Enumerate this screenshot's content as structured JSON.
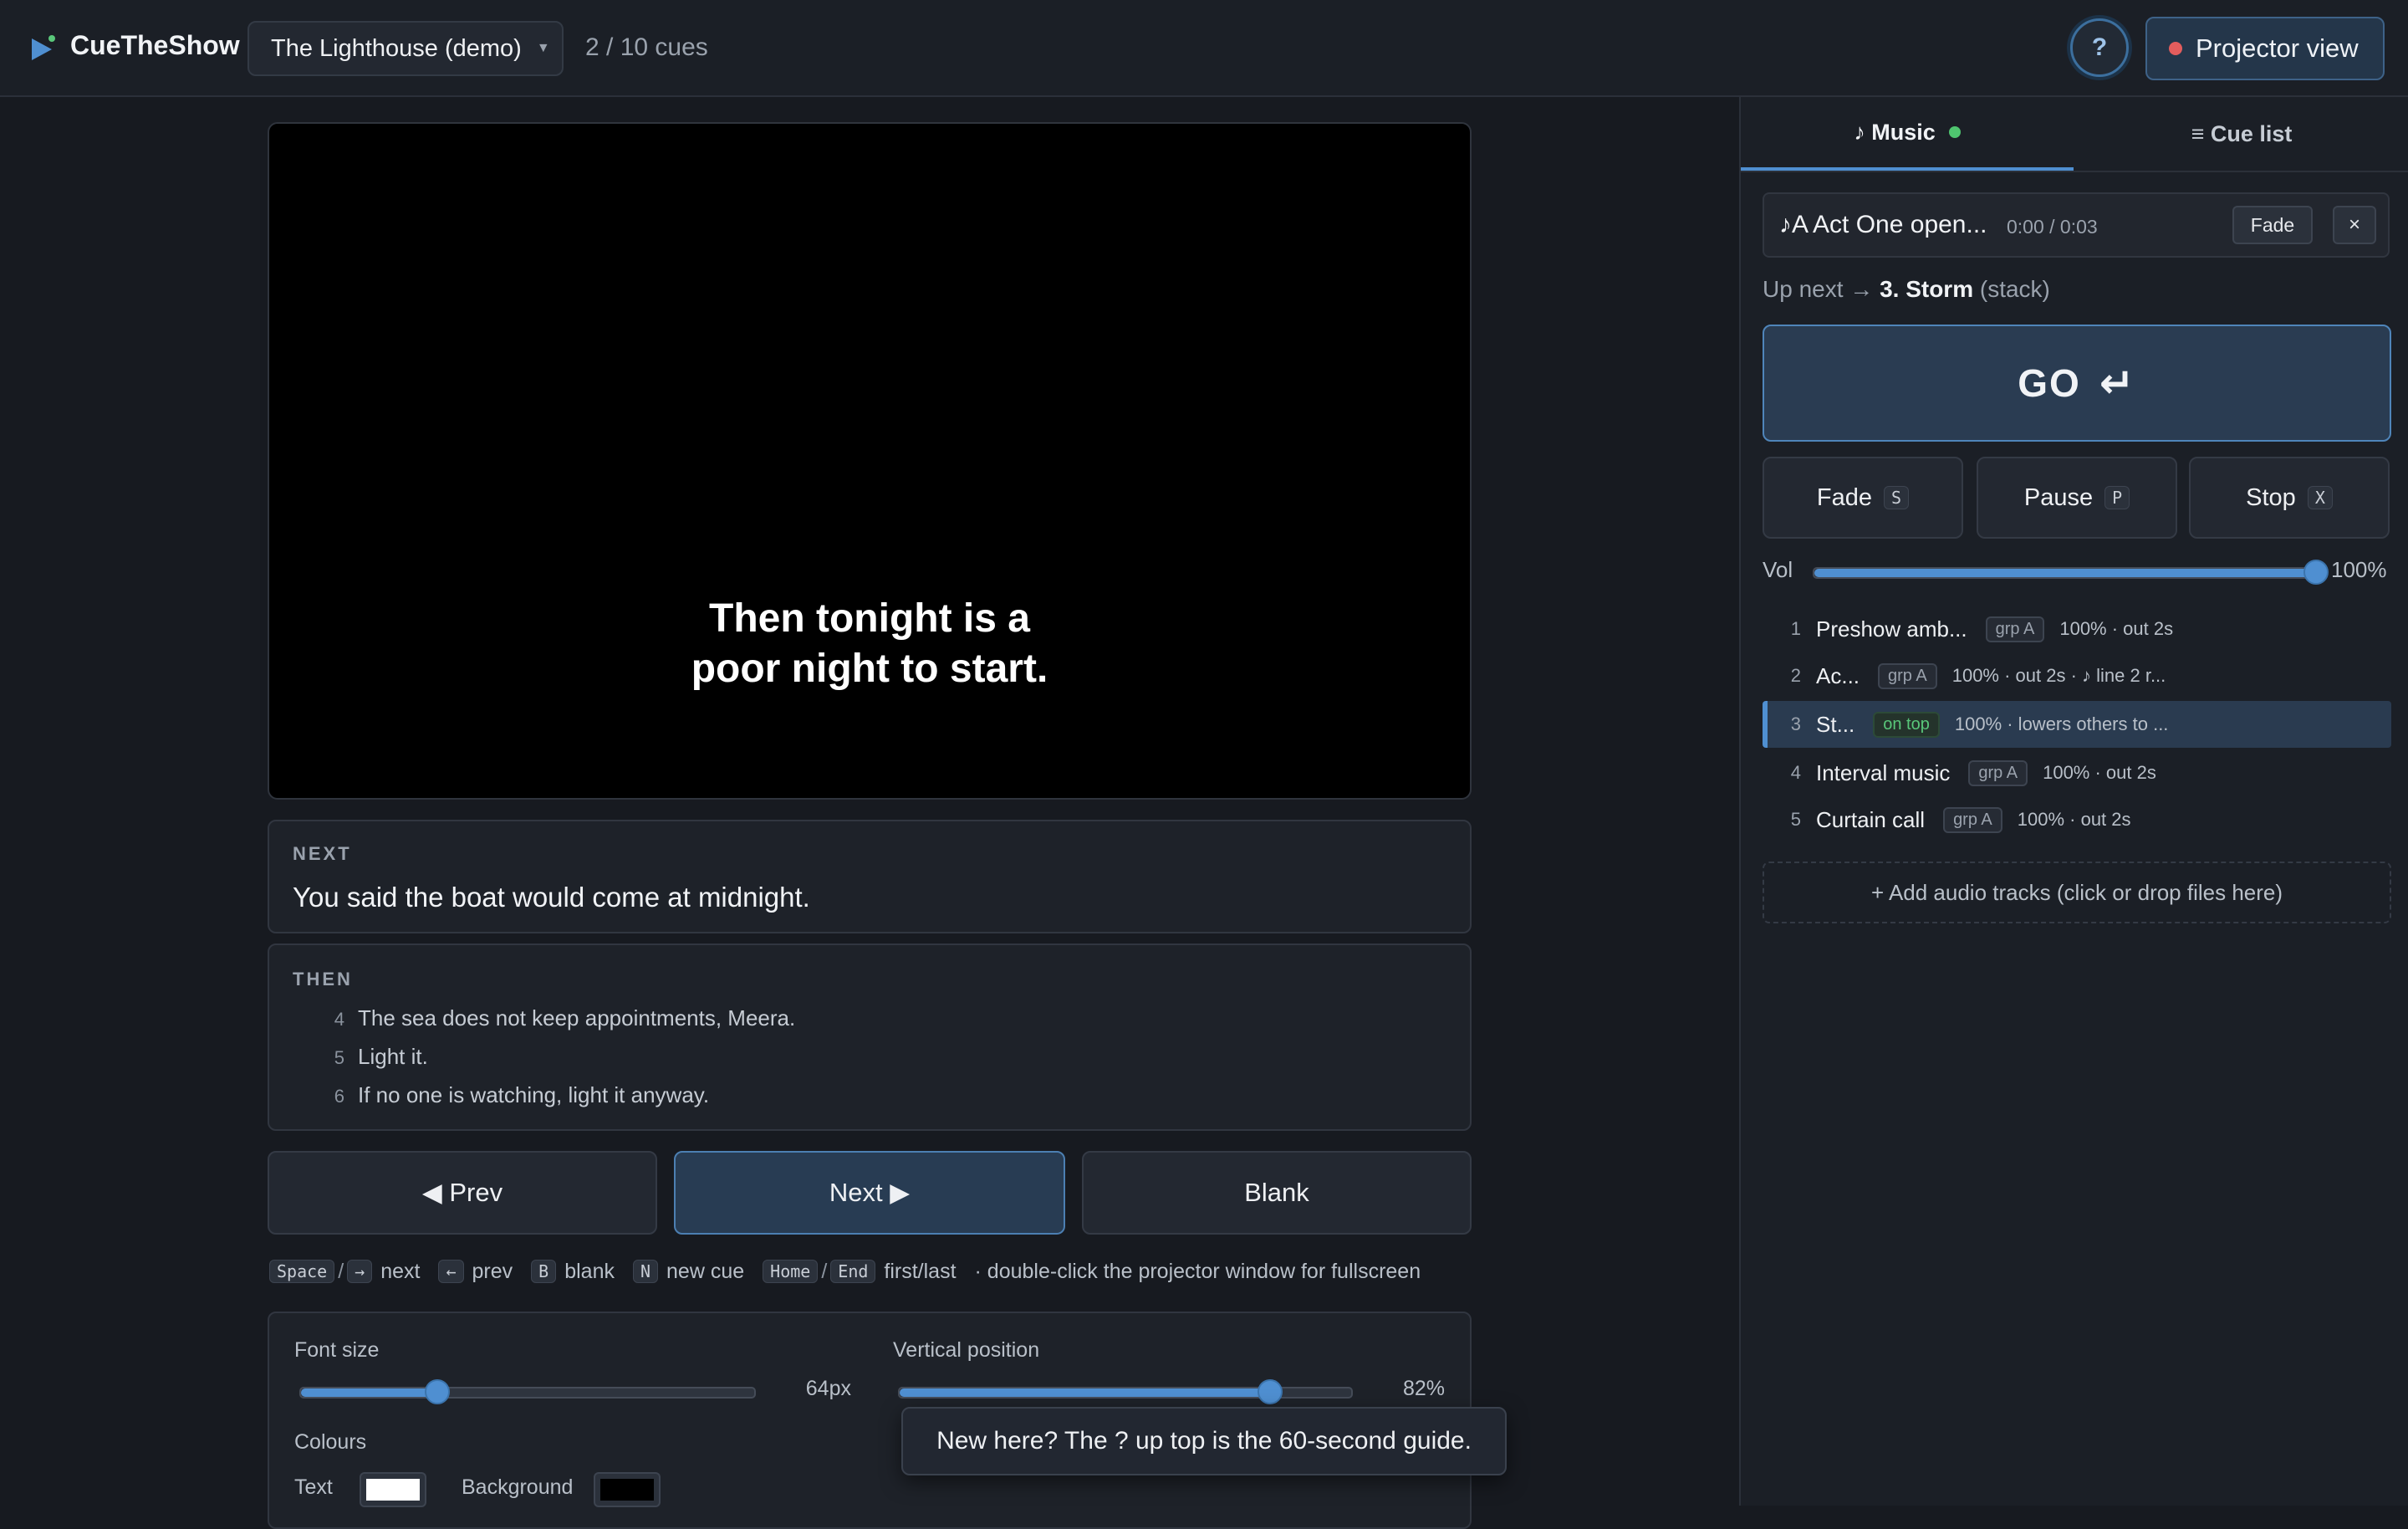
{
  "app": {
    "brand": "CueTheShow",
    "project": "The Lighthouse (demo)",
    "cue_count": "2 / 10 cues",
    "help_label": "?",
    "projector_label": "Projector view",
    "accent_color": "#4f8fd1"
  },
  "stage": {
    "line1": "Then tonight is a",
    "line2": "poor night to start."
  },
  "next": {
    "label": "NEXT",
    "text": "You said the boat would come at midnight."
  },
  "then": {
    "label": "THEN",
    "items": [
      {
        "num": "4",
        "text": "The sea does not keep appointments, Meera."
      },
      {
        "num": "5",
        "text": "Light it."
      },
      {
        "num": "6",
        "text": "If no one is watching, light it anyway."
      }
    ]
  },
  "nav": {
    "prev": "◀ Prev",
    "next": "Next ▶",
    "blank": "Blank"
  },
  "shortcuts": {
    "space": "Space",
    "right": "→",
    "next": "next",
    "left": "←",
    "prev": "prev",
    "b": "B",
    "blank": "blank",
    "n": "N",
    "new_cue": "new cue",
    "home": "Home",
    "end": "End",
    "first_last": "first/last",
    "tip": "· double-click the projector window for fullscreen"
  },
  "settings": {
    "font_size_label": "Font size",
    "font_size_value": "64px",
    "font_size_fraction": 0.3,
    "vpos_label": "Vertical position",
    "vpos_value": "82%",
    "vpos_fraction": 0.82,
    "colours_label": "Colours",
    "text_label": "Text",
    "text_color": "#ffffff",
    "bg_label": "Background",
    "bg_color": "#000000"
  },
  "toast": "New here? The ? up top is the 60-second guide.",
  "sidebar": {
    "tab_music": "♪ Music",
    "tab_cues": "≡ Cue list",
    "now_playing": {
      "title": "♪A Act One open...",
      "time": "0:00 / 0:03",
      "fade": "Fade",
      "close": "×"
    },
    "up_next_prefix": "Up next →",
    "up_next_name": "3. Storm",
    "up_next_suffix": "(stack)",
    "go_label": "GO",
    "go_icon": "↵",
    "controls": [
      {
        "label": "Fade",
        "key": "S"
      },
      {
        "label": "Pause",
        "key": "P"
      },
      {
        "label": "Stop",
        "key": "X"
      }
    ],
    "vol_label": "Vol",
    "vol_value": "100%",
    "vol_fraction": 1.0,
    "tracks": [
      {
        "num": "1",
        "name": "Preshow amb...",
        "badge": "grp A",
        "meta": "100% · out 2s"
      },
      {
        "num": "2",
        "name": "Ac...",
        "badge": "grp A",
        "meta": "100% · out 2s · ♪ line 2 r..."
      },
      {
        "num": "3",
        "name": "St...",
        "badge": "on top",
        "meta": "100% · lowers others to ..."
      },
      {
        "num": "4",
        "name": "Interval music",
        "badge": "grp A",
        "meta": "100% · out 2s"
      },
      {
        "num": "5",
        "name": "Curtain call",
        "badge": "grp A",
        "meta": "100% · out 2s"
      }
    ],
    "add_tracks": "+ Add audio tracks (click or drop files here)"
  }
}
